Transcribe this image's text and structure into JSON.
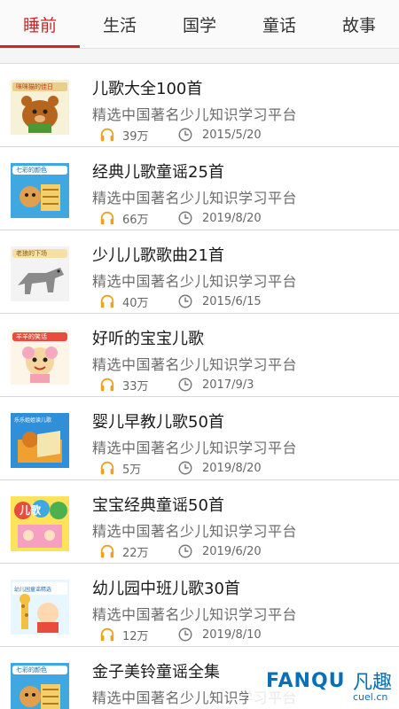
{
  "tabs": [
    {
      "label": "睡前",
      "active": true
    },
    {
      "label": "生活",
      "active": false
    },
    {
      "label": "国学",
      "active": false
    },
    {
      "label": "童话",
      "active": false
    },
    {
      "label": "故事",
      "active": false
    }
  ],
  "colors": {
    "accent": "#c62828",
    "icon_orange": "#f0a020"
  },
  "items": [
    {
      "title": "儿歌大全100首",
      "desc": "精选中国著名少儿知识学习平台",
      "plays": "39万",
      "date": "2015/5/20",
      "cover_text": "咪咪猫的佳日",
      "cover": "bear"
    },
    {
      "title": "经典儿歌童谣25首",
      "desc": "精选中国著名少儿知识学习平台",
      "plays": "66万",
      "date": "2019/8/20",
      "cover_text": "七彩的颜色",
      "cover": "blue"
    },
    {
      "title": "少儿儿歌歌曲21首",
      "desc": "精选中国著名少儿知识学习平台",
      "plays": "40万",
      "date": "2015/6/15",
      "cover_text": "老狼的下场",
      "cover": "wolf"
    },
    {
      "title": "好听的宝宝儿歌",
      "desc": "精选中国著名少儿知识学习平台",
      "plays": "33万",
      "date": "2017/9/3",
      "cover_text": "羊羊的笑话",
      "cover": "sheep"
    },
    {
      "title": "婴儿早教儿歌50首",
      "desc": "精选中国著名少儿知识学习平台",
      "plays": "5万",
      "date": "2019/8/20",
      "cover_text": "乐乐姐姐读儿歌",
      "cover": "reading"
    },
    {
      "title": "宝宝经典童谣50首",
      "desc": "精选中国著名少儿知识学习平台",
      "plays": "22万",
      "date": "2019/6/20",
      "cover_text": "儿歌",
      "cover": "colorful"
    },
    {
      "title": "幼儿园中班儿歌30首",
      "desc": "精选中国著名少儿知识学习平台",
      "plays": "12万",
      "date": "2019/8/10",
      "cover_text": "幼儿园童谣精选",
      "cover": "giraffe"
    },
    {
      "title": "金子美铃童谣全集",
      "desc": "精选中国著名少儿知识学习平台",
      "plays": "",
      "date": "",
      "cover_text": "七彩的颜色",
      "cover": "blue"
    }
  ],
  "watermark": {
    "brand": "FANQU",
    "cn": "凡趣",
    "site": "cuel.cn"
  }
}
